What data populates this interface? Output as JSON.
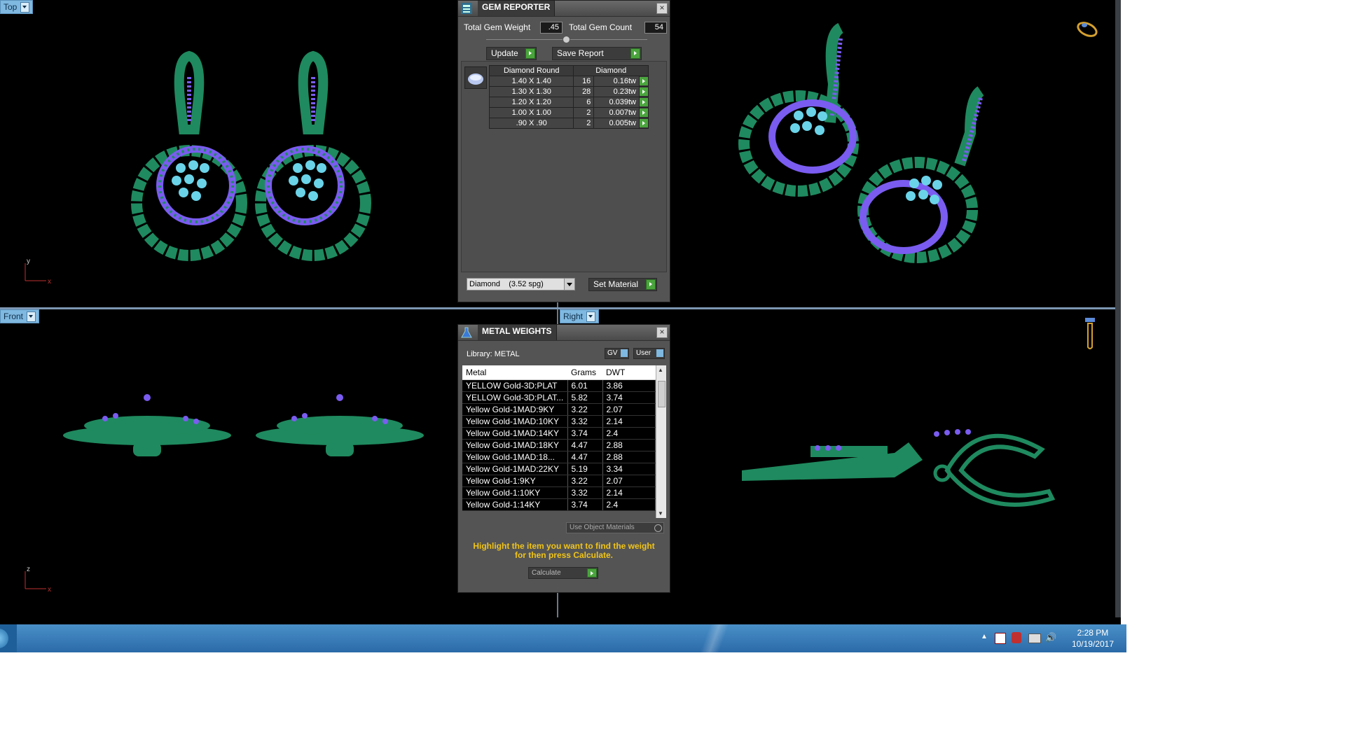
{
  "viewports": {
    "top_label": "Top",
    "front_label": "Front",
    "right_label": "Right",
    "axes": {
      "top_y": "y",
      "top_x": "x",
      "front_z": "z",
      "front_x": "x"
    }
  },
  "gem_reporter": {
    "title": "GEM REPORTER",
    "total_weight_label": "Total Gem Weight",
    "total_weight_value": ".45",
    "total_count_label": "Total Gem Count",
    "total_count_value": "54",
    "update_label": "Update",
    "save_report_label": "Save Report",
    "table_headers": [
      "Diamond Round",
      "Diamond"
    ],
    "rows": [
      {
        "size": "1.40 X 1.40",
        "count": "16",
        "weight": "0.16tw"
      },
      {
        "size": "1.30 X 1.30",
        "count": "28",
        "weight": "0.23tw"
      },
      {
        "size": "1.20 X 1.20",
        "count": "6",
        "weight": "0.039tw"
      },
      {
        "size": "1.00 X 1.00",
        "count": "2",
        "weight": "0.007tw"
      },
      {
        "size": ".90 X .90",
        "count": "2",
        "weight": "0.005tw"
      }
    ],
    "material_select": "Diamond    (3.52 spg)",
    "set_material_label": "Set Material"
  },
  "metal_weights": {
    "title": "METAL WEIGHTS",
    "library_label": "Library: METAL",
    "gv_label": "GV",
    "user_label": "User",
    "columns": [
      "Metal",
      "Grams",
      "DWT"
    ],
    "rows": [
      {
        "metal": "YELLOW Gold-3D:PLAT",
        "grams": "6.01",
        "dwt": "3.86"
      },
      {
        "metal": "YELLOW Gold-3D:PLAT...",
        "grams": "5.82",
        "dwt": "3.74"
      },
      {
        "metal": "Yellow Gold-1MAD:9KY",
        "grams": "3.22",
        "dwt": "2.07"
      },
      {
        "metal": "Yellow Gold-1MAD:10KY",
        "grams": "3.32",
        "dwt": "2.14"
      },
      {
        "metal": "Yellow Gold-1MAD:14KY",
        "grams": "3.74",
        "dwt": "2.4"
      },
      {
        "metal": "Yellow Gold-1MAD:18KY",
        "grams": "4.47",
        "dwt": "2.88"
      },
      {
        "metal": "Yellow Gold-1MAD:18...",
        "grams": "4.47",
        "dwt": "2.88"
      },
      {
        "metal": "Yellow Gold-1MAD:22KY",
        "grams": "5.19",
        "dwt": "3.34"
      },
      {
        "metal": "Yellow Gold-1:9KY",
        "grams": "3.22",
        "dwt": "2.07"
      },
      {
        "metal": "Yellow Gold-1:10KY",
        "grams": "3.32",
        "dwt": "2.14"
      },
      {
        "metal": "Yellow Gold-1:14KY",
        "grams": "3.74",
        "dwt": "2.4"
      }
    ],
    "use_object_materials": "Use Object Materials",
    "instruction": "Highlight the item you want to find the weight for then press Calculate.",
    "calculate_label": "Calculate"
  },
  "taskbar": {
    "time": "2:28 PM",
    "date": "10/19/2017"
  },
  "colors": {
    "jewelry_green": "#1f8a5f",
    "gem_blue": "#6ad3e8",
    "gem_purple": "#7a5cf0",
    "instruction_yellow": "#f0c419"
  }
}
